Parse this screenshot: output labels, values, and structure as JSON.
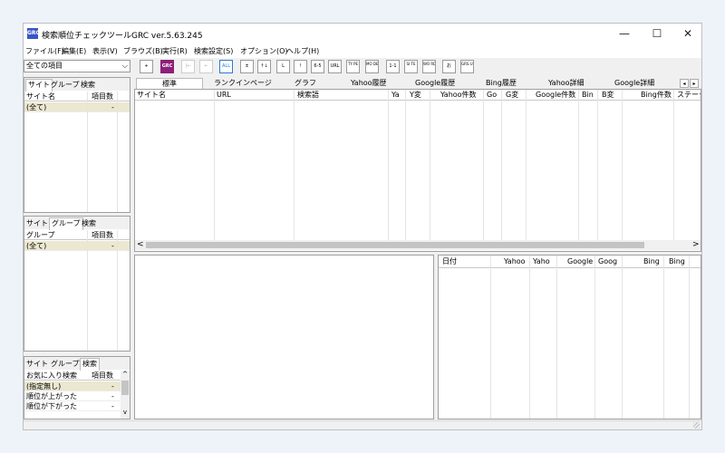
{
  "window": {
    "title": "検索順位チェックツールGRC  ver.5.63.245",
    "icon_label": "GRC",
    "minimize": "—",
    "maximize": "☐",
    "close": "✕"
  },
  "menu": [
    "ファイル(F)",
    "編集(E)",
    "表示(V)",
    "ブラウズ(B)",
    "実行(R)",
    "検索設定(S)",
    "オプション(O)",
    "ヘルプ(H)"
  ],
  "toolbar": {
    "combo_value": "全ての項目",
    "combo_arrow": "⌵",
    "buttons": [
      "+",
      "GRC",
      "|←",
      "←",
      "ALL",
      "±",
      "↑↓",
      "L",
      "!",
      "6-5",
      "URL",
      "TY PE",
      "MO DE",
      "1-1",
      "SI TE",
      "WO RD",
      "お",
      "GRS UP"
    ]
  },
  "left_panels": [
    {
      "tabs": [
        "サイト",
        "グループ",
        "検索"
      ],
      "headers": [
        "サイト名",
        "項目数"
      ],
      "rows": [
        [
          "(全て)",
          "-"
        ]
      ]
    },
    {
      "tabs": [
        "サイト",
        "グループ",
        "検索"
      ],
      "headers": [
        "グループ",
        "項目数"
      ],
      "rows": [
        [
          "(全て)",
          "-"
        ]
      ]
    },
    {
      "tabs": [
        "サイト",
        "グループ",
        "検索"
      ],
      "headers": [
        "お気に入り検索",
        "項目数"
      ],
      "rows": [
        [
          "(指定無し)",
          "-"
        ],
        [
          "順位が上がった",
          "-"
        ],
        [
          "順位が下がった",
          "-"
        ]
      ],
      "scroll_up": "^",
      "scroll_down": "v"
    }
  ],
  "main_tabs": [
    "標準",
    "ランクインページ",
    "グラフ",
    "Yahoo履歴",
    "Google履歴",
    "Bing履歴",
    "Yahoo詳細",
    "Google詳細"
  ],
  "tab_scroll": [
    "◂",
    "▸"
  ],
  "main_columns": [
    "サイト名",
    "URL",
    "検索語",
    "Ya",
    "Y変",
    "Yahoo件数",
    "Go",
    "G変",
    "Google件数",
    "Bin",
    "B変",
    "Bing件数",
    "ステータ"
  ],
  "hscroll": {
    "left": "<",
    "right": ">"
  },
  "history_columns": [
    "日付",
    "Yahoo",
    "Yaho",
    "Google",
    "Goog",
    "Bing",
    "Bing"
  ]
}
